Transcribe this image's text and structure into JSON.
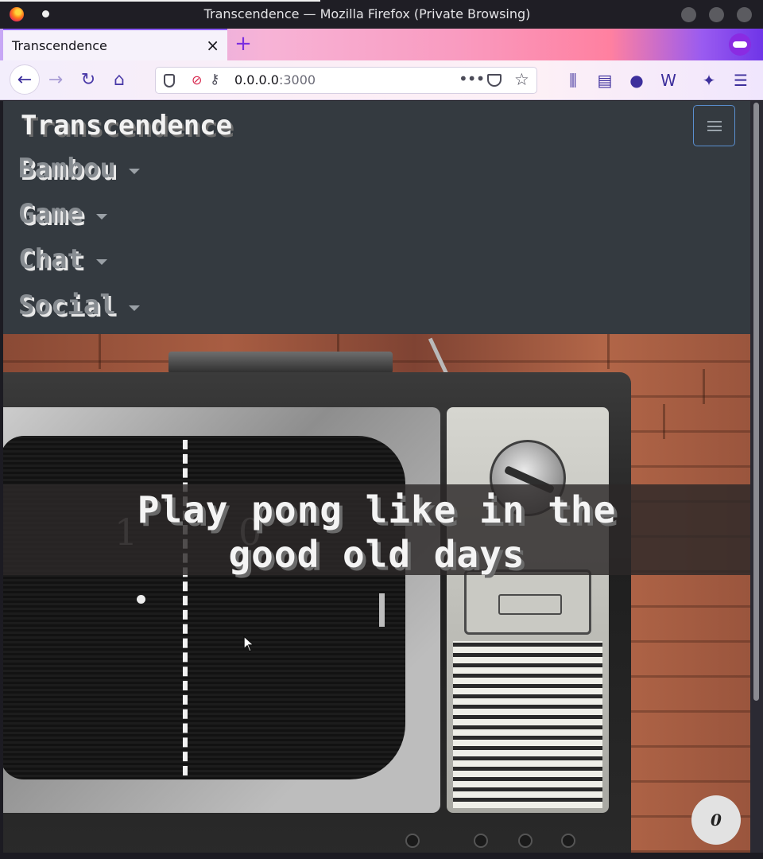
{
  "window": {
    "title": "Transcendence — Mozilla Firefox (Private Browsing)"
  },
  "tab": {
    "label": "Transcendence",
    "close_glyph": "×",
    "new_tab_glyph": "+"
  },
  "toolbar": {
    "back_glyph": "←",
    "forward_glyph": "→",
    "reload_glyph": "↻",
    "home_glyph": "⌂",
    "url_host": "0.0.0.0",
    "url_port": ":3000",
    "more_glyph": "•••",
    "star_glyph": "☆",
    "library_glyph": "⫼",
    "sidebar_glyph": "▤",
    "account_glyph": "●",
    "extension_glyph": "W",
    "gift_glyph": "✦",
    "menu_glyph": "☰"
  },
  "site": {
    "brand": "Transcendence",
    "nav": [
      {
        "label": "Bambou"
      },
      {
        "label": "Game"
      },
      {
        "label": "Chat"
      },
      {
        "label": "Social"
      }
    ],
    "hero": {
      "headline_line1": "Play pong like in the",
      "headline_line2": "good old days",
      "score_left": "1",
      "score_right": "0"
    },
    "counter": "0"
  },
  "colors": {
    "navbar_bg": "#343a40",
    "toggler_border": "#5a8fd0",
    "accent_purple": "#8b5cf6"
  }
}
